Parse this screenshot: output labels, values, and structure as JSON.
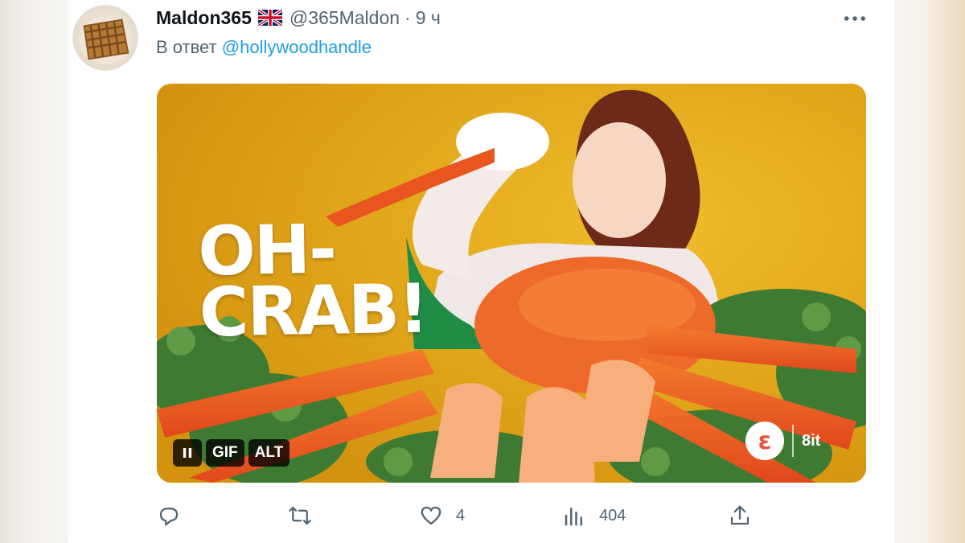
{
  "tweet": {
    "author_name": "Maldon365",
    "author_flag": "uk-flag-icon",
    "author_handle": "@365Maldon",
    "separator": "·",
    "time": "9 ч",
    "reply_prefix": "В ответ",
    "reply_to": "@hollywoodhandle"
  },
  "media": {
    "overlay_line1": "OH-",
    "overlay_line2": "CRAB!",
    "controls": {
      "pause_label": "II",
      "gif_label": "GIF",
      "alt_label": "ALT"
    },
    "brand_logo": "ɛ",
    "brand_text": "8it"
  },
  "actions": {
    "reply_count": "",
    "retweet_count": "",
    "like_count": "4",
    "views_count": "404"
  },
  "colors": {
    "link": "#1d9bf0",
    "secondary_text": "#536471",
    "primary_text": "#0f1419",
    "gif_background": "#e0a818"
  }
}
